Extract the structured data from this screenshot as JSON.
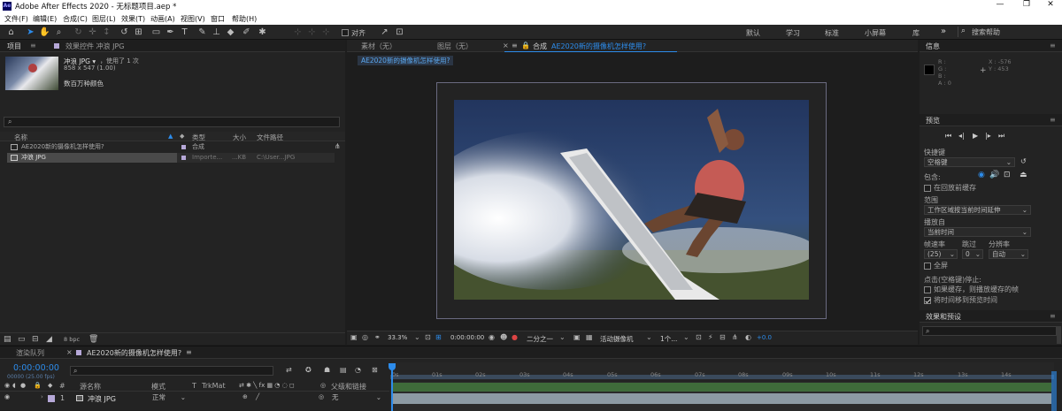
{
  "app": {
    "title": "Adobe After Effects 2020 - 无标题项目.aep *",
    "icon_text": "Ae",
    "window_controls": [
      "—",
      "❐",
      "✕"
    ]
  },
  "menu": [
    "文件(F)",
    "编辑(E)",
    "合成(C)",
    "图层(L)",
    "效果(T)",
    "动画(A)",
    "视图(V)",
    "窗口",
    "帮助(H)"
  ],
  "toolbar": {
    "snap_label": "对齐",
    "workspaces": [
      "默认",
      "学习",
      "标准",
      "小屏幕",
      "库"
    ],
    "more": "»",
    "search_placeholder": "搜索帮助"
  },
  "project": {
    "tab_project": "项目",
    "tab_effects": "效果控件 冲浪 JPG",
    "item_name": "冲浪 JPG ▾",
    "item_used": "，使用了 1 次",
    "item_dims": "858 x 547 (1.00)",
    "item_colors": "数百万种颜色",
    "search_placeholder": "",
    "columns": [
      "名称",
      "类型",
      "大小",
      "文件路径"
    ],
    "rows": [
      {
        "name": "AE2020新的摄像机怎样使用?",
        "type": "合成",
        "size": "",
        "path": ""
      },
      {
        "name": "冲浪 JPG",
        "type": "Importe...",
        "size": "...KB",
        "path": "C:\\User...JPG"
      }
    ],
    "bpc": "8 bpc"
  },
  "viewer": {
    "tab_footage": "素材（无）",
    "tab_layer": "图层（无）",
    "tab_comp_prefix": "合成",
    "tab_comp_name": "AE2020新的摄像机怎样使用?",
    "comp_chip": "AE2020新的摄像机怎样使用?",
    "zoom": "33.3%",
    "timecode": "0:00:00:00",
    "resolution": "二分之一",
    "camera": "活动摄像机",
    "views": "1个...",
    "exposure": "+0.0"
  },
  "info": {
    "title": "信息",
    "r": "R :",
    "g": "G :",
    "b": "B :",
    "a": "A : 0",
    "x": "X : -576",
    "y": "Y : 453"
  },
  "preview": {
    "title": "预览",
    "shortcut_label": "快捷键",
    "shortcut_value": "空格键",
    "include_label": "包含:",
    "cache_before": "在回放前缓存",
    "range_label": "范围",
    "range_value": "工作区域按当前时间延伸",
    "play_from_label": "播放自",
    "play_from_value": "当前时间",
    "fps_label": "帧速率",
    "skip_label": "跳过",
    "res_label": "分辨率",
    "fps_value": "(25)",
    "skip_value": "0",
    "res_value": "自动",
    "fullscreen": "全屏",
    "stop_label": "点击(空格键)停止:",
    "stop_opt1": "如果缓存，则播放缓存的帧",
    "stop_opt2": "将时间移到预览时间"
  },
  "effects": {
    "title": "效果和预设",
    "search_placeholder": ""
  },
  "timeline": {
    "tab_render": "渲染队列",
    "tab_comp": "AE2020新的摄像机怎样使用?",
    "timecode": "0:00:00:00",
    "frame_info": "00000 (25.00 fps)",
    "search_placeholder": "",
    "col_num": "#",
    "col_name": "源名称",
    "col_mode": "模式",
    "col_t": "T",
    "col_trkmat": "TrkMat",
    "col_parent": "父级和链接",
    "layer_num": "1",
    "layer_name": "冲浪 JPG",
    "layer_mode": "正常",
    "layer_parent": "无",
    "ruler": [
      "0s",
      "01s",
      "02s",
      "03s",
      "04s",
      "05s",
      "06s",
      "07s",
      "08s",
      "09s",
      "10s",
      "11s",
      "12s",
      "13s",
      "14s"
    ]
  },
  "colors": {
    "accent": "#2d8ceb",
    "bg": "#1d1d1d",
    "panel": "#232323",
    "layer_bar": "#8c9aa3",
    "work_area": "#3a4a5c"
  }
}
